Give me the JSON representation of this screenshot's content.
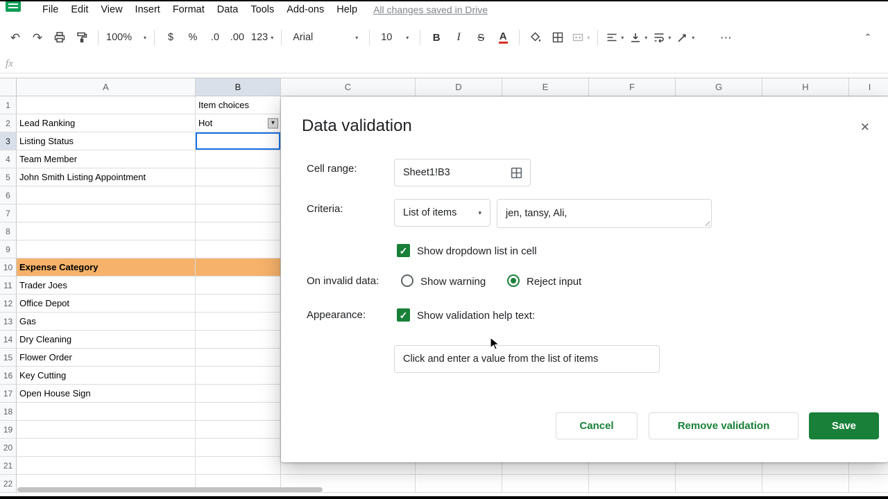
{
  "colors": {
    "green": "#188038",
    "orange": "#f6b26b",
    "blue": "#1a73e8",
    "headerbg": "#f8f9fa",
    "selhead": "#d9e0ea",
    "gridline": "#dcdcdc"
  },
  "icons": {
    "undo": "↶",
    "redo": "↷",
    "dropdown_small": "▼",
    "caret": "▾",
    "close": "✕",
    "check": "✓",
    "more": "⋯",
    "collapse": "⌃"
  },
  "menu": {
    "items": [
      "File",
      "Edit",
      "View",
      "Insert",
      "Format",
      "Data",
      "Tools",
      "Add-ons",
      "Help"
    ],
    "status": "All changes saved in Drive"
  },
  "toolbar": {
    "zoom": "100%",
    "currency": "$",
    "percent": "%",
    "decrease_decimal": ".0",
    "increase_decimal": ".00",
    "more_formats": "123",
    "font": "Arial",
    "font_size": "10",
    "bold": "B",
    "italic": "I",
    "strikethrough": "S",
    "text_color": "A"
  },
  "formula_bar": {
    "fx": "fx"
  },
  "grid": {
    "columns": [
      "A",
      "B",
      "C",
      "D",
      "E",
      "F",
      "G",
      "H",
      "I"
    ],
    "row_count": 22,
    "selected_column": "B",
    "selected_row": 3,
    "selected_cell": "B3",
    "dropdown_cell": "B2",
    "orange_cells": [
      "A10",
      "B10"
    ],
    "bold_cells": [
      "A10"
    ],
    "cells": {
      "B1": "Item choices",
      "A2": "Lead Ranking",
      "B2": "Hot",
      "A3": "Listing Status",
      "A4": "Team Member",
      "A5": "John Smith Listing Appointment",
      "A10": "Expense Category",
      "A11": "Trader Joes",
      "A12": "Office Depot",
      "A13": "Gas",
      "A14": "Dry Cleaning",
      "A15": "Flower Order",
      "A16": "Key Cutting",
      "A17": "Open House Sign"
    }
  },
  "dialog": {
    "title": "Data validation",
    "cell_range_label": "Cell range:",
    "cell_range_value": "Sheet1!B3",
    "criteria_label": "Criteria:",
    "criteria_type": "List of items",
    "criteria_value": "jen, tansy, Ali,",
    "show_dropdown_label": "Show dropdown list in cell",
    "on_invalid_label": "On invalid data:",
    "radio_warning": "Show warning",
    "radio_reject": "Reject input",
    "appearance_label": "Appearance:",
    "help_checkbox_label": "Show validation help text:",
    "help_text_value": "Click and enter a value from the list of items",
    "buttons": {
      "cancel": "Cancel",
      "remove": "Remove validation",
      "save": "Save"
    }
  }
}
